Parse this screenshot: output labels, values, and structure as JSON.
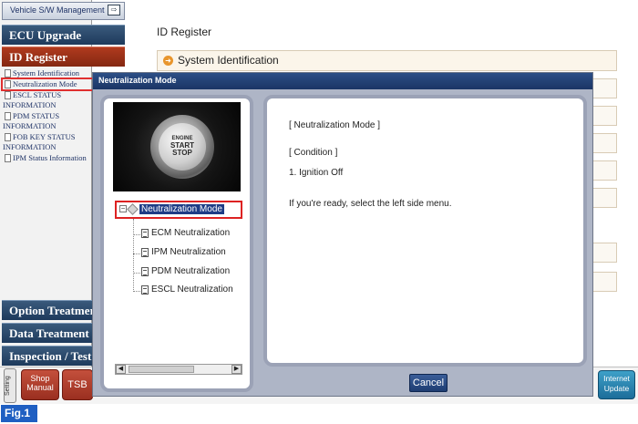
{
  "sidebar": {
    "top_item": "Vehicle S/W Management",
    "menu": {
      "ecu_upgrade": "ECU Upgrade",
      "id_register": "ID Register",
      "option_treatment": "Option Treatmer",
      "data_treatment": "Data Treatment",
      "inspection_test": "Inspection / Test"
    },
    "items": [
      {
        "label": "System Identification",
        "selected": false
      },
      {
        "label": "Neutralization Mode",
        "selected": true
      },
      {
        "label": "ESCL STATUS INFORMATION",
        "selected": false
      },
      {
        "label": "PDM STATUS INFORMATION",
        "selected": false
      },
      {
        "label": "FOB KEY STATUS INFORMATION",
        "selected": false
      },
      {
        "label": "IPM Status Information",
        "selected": false
      }
    ]
  },
  "bottom_bar": {
    "setting": "Setting",
    "shop_manual": "Shop Manual",
    "tsb": "TSB",
    "internet_update": "Internet Update"
  },
  "main": {
    "title": "ID Register",
    "section": "System Identification"
  },
  "dialog": {
    "title": "Neutralization Mode",
    "photo": {
      "line1": "ENGINE",
      "line2": "START",
      "line3": "STOP"
    },
    "tree": {
      "root": "Neutralization Mode",
      "children": [
        "ECM Neutralization",
        "IPM Neutralization",
        "PDM Neutralization",
        "ESCL Neutralization"
      ]
    },
    "info": {
      "heading": "[ Neutralization Mode ]",
      "condition": "[ Condition ]",
      "ignition": "1. Ignition Off",
      "ready": "If you're ready, select the left side menu."
    },
    "cancel": "Cancel"
  },
  "figure_label": "Fig.1",
  "colors": {
    "menu_navy": "#1e3a5c",
    "menu_selected": "#842812",
    "dialog_titlebar": "#1b3565",
    "selection_outline": "#dd2222",
    "figure_label_bg": "#1f5fc2"
  }
}
